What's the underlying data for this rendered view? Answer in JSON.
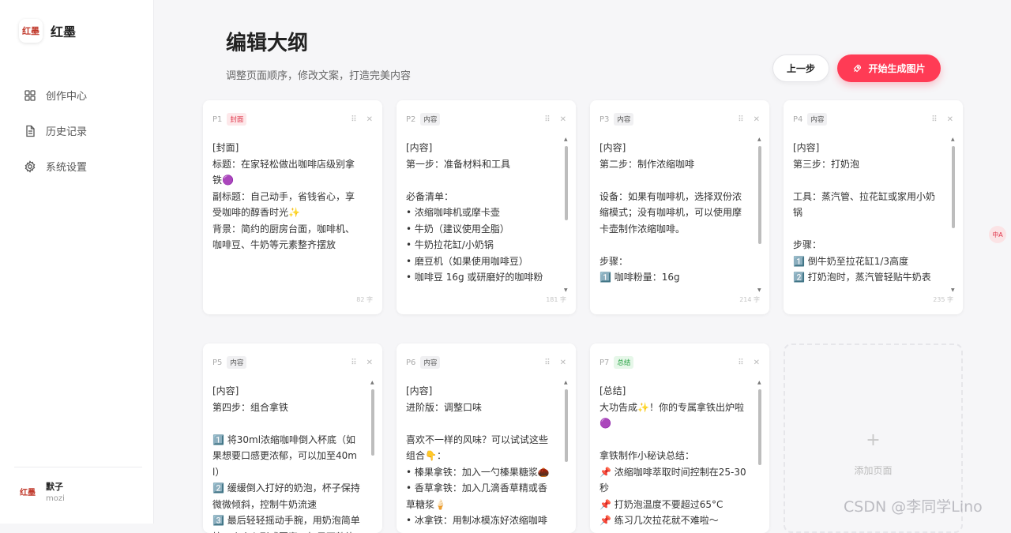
{
  "app": {
    "logo_text": "红墨",
    "name": "红墨"
  },
  "sidebar": {
    "items": [
      {
        "label": "创作中心",
        "icon": "grid-icon"
      },
      {
        "label": "历史记录",
        "icon": "document-icon"
      },
      {
        "label": "系统设置",
        "icon": "gear-icon"
      }
    ],
    "user": {
      "avatar_text": "红墨",
      "name": "默子",
      "id": "mozi"
    }
  },
  "header": {
    "title": "编辑大纲",
    "subtitle": "调整页面顺序，修改文案，打造完美内容",
    "prev_label": "上一步",
    "generate_label": "开始生成图片"
  },
  "cards": [
    {
      "page": "P1",
      "tag": "封面",
      "count": "82 字",
      "text": "[封面]\n标题：在家轻松做出咖啡店级别拿铁🟣\n副标题：自己动手，省钱省心，享受咖啡的醇香时光✨\n背景：简约的厨房台面，咖啡机、咖啡豆、牛奶等元素整齐摆放"
    },
    {
      "page": "P2",
      "tag": "内容",
      "count": "181 字",
      "text": "[内容]\n第一步：准备材料和工具\n\n必备清单：\n• 浓缩咖啡机或摩卡壶\n• 牛奶（建议使用全脂）\n• 牛奶拉花缸/小奶锅\n• 磨豆机（如果使用咖啡豆）\n• 咖啡豆 16g 或研磨好的咖啡粉"
    },
    {
      "page": "P3",
      "tag": "内容",
      "count": "214 字",
      "text": "[内容]\n第二步：制作浓缩咖啡\n\n设备：如果有咖啡机，选择双份浓缩模式；没有咖啡机，可以使用摩卡壶制作浓缩咖啡。\n\n步骤：\n1️⃣ 咖啡粉量：16g"
    },
    {
      "page": "P4",
      "tag": "内容",
      "count": "235 字",
      "text": "[内容]\n第三步：打奶泡\n\n工具：蒸汽管、拉花缸或家用小奶锅\n\n步骤：\n1️⃣ 倒牛奶至拉花缸1/3高度\n2️⃣ 打奶泡时，蒸汽管轻贴牛奶表面，小幅度上下移动，直到牛奶体积"
    },
    {
      "page": "P5",
      "tag": "内容",
      "count": "",
      "text": "[内容]\n第四步：组合拿铁\n\n1️⃣ 将30ml浓缩咖啡倒入杯底（如果想要口感更浓郁，可以加至40ml）\n2️⃣ 缓缓倒入打好的奶泡，杯子保持微微倾斜，控制牛奶流速\n3️⃣ 最后轻轻摇动手腕，用奶泡简单拉一个小心形或图案，如果不熟练"
    },
    {
      "page": "P6",
      "tag": "内容",
      "count": "",
      "text": "[内容]\n进阶版：调整口味\n\n喜欢不一样的风味？可以试试这些组合👇：\n• 榛果拿铁：加入一勺榛果糖浆🌰\n• 香草拿铁：加入几滴香草精或香草糖浆🍦\n• 冰拿铁：用制冰模冻好浓缩咖啡"
    },
    {
      "page": "P7",
      "tag": "总结",
      "count": "",
      "text": "[总结]\n大功告成✨！你的专属拿铁出炉啦🟣\n\n拿铁制作小秘诀总结：\n📌 浓缩咖啡萃取时间控制在25-30秒\n📌 打奶泡温度不要超过65°C\n📌 练习几次拉花就不难啦～"
    }
  ],
  "add_page": {
    "label": "添加页面"
  },
  "float_badge": "中A",
  "watermark": "CSDN @李同学Lino",
  "colors": {
    "accent": "#ff3b55",
    "cover_tag": "#e0394d",
    "summary_tag": "#27a243"
  }
}
